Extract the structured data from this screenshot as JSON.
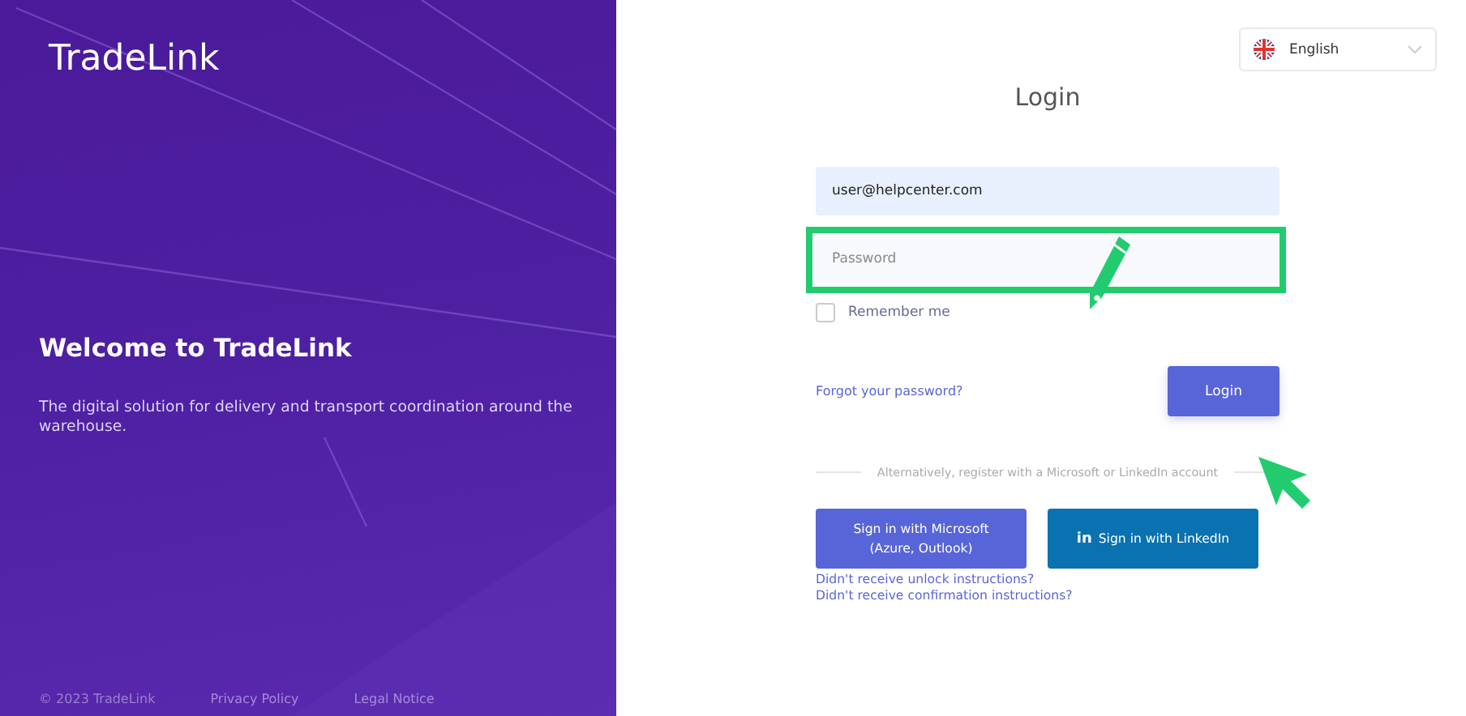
{
  "hero": {
    "logo": "TradeLink",
    "heading": "Welcome to TradeLink",
    "description": "The digital solution for delivery and transport coordination around the warehouse.",
    "footer": [
      {
        "kind": "text",
        "label": "© 2023 TradeLink"
      },
      {
        "kind": "link",
        "label": "Privacy Policy"
      },
      {
        "kind": "link",
        "label": "Legal Notice"
      }
    ]
  },
  "language": {
    "value": "English"
  },
  "login": {
    "title": "Login",
    "email": {
      "value": "user@helpcenter.com"
    },
    "password": {
      "placeholder": "Password",
      "highlighted": true
    },
    "remember": {
      "label": "Remember me",
      "checked": false
    },
    "forgot_link": "Forgot your password?",
    "submit": "Login",
    "divider": "Alternatively, register with a Microsoft or LinkedIn account",
    "sso": [
      {
        "kind": "microsoft",
        "label": "Sign in with Microsoft",
        "sublabel": "(Azure, Outlook)"
      },
      {
        "kind": "linkedin",
        "icon_text": "in",
        "label": "Sign in with LinkedIn"
      }
    ],
    "help_links": [
      "Didn't receive unlock instructions?",
      "Didn't receive confirmation instructions?"
    ]
  }
}
